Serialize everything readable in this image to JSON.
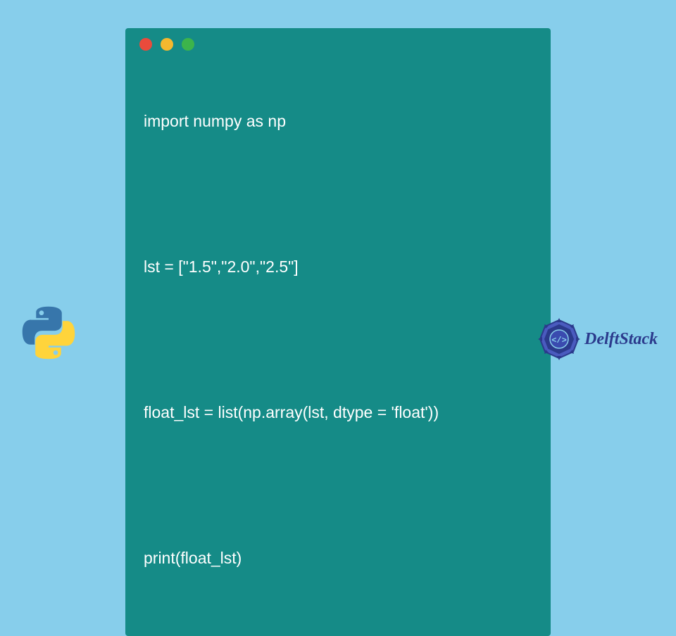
{
  "code": {
    "lines": [
      "import numpy as np",
      "",
      "lst = [\"1.5\",\"2.0\",\"2.5\"]",
      "",
      "float_lst = list(np.array(lst, dtype = 'float'))",
      "",
      "print(float_lst)"
    ]
  },
  "brand": {
    "name": "DelftStack"
  },
  "colors": {
    "background": "#87CEEB",
    "code_window": "#158B87",
    "dot_red": "#E94B3C",
    "dot_yellow": "#F5B82E",
    "dot_green": "#3CB44B",
    "brand_text": "#2B3A8C"
  }
}
